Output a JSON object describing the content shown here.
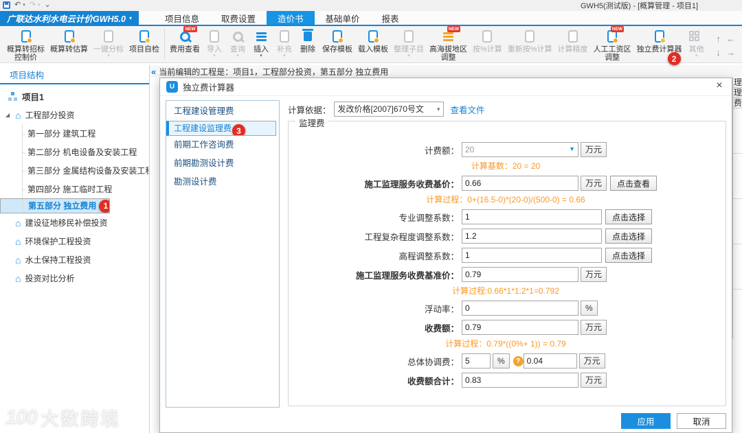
{
  "colors": {
    "accent": "#1583d3",
    "tab_active": "#1794e4",
    "orange": "#fb9827",
    "badge_red": "#e42c22",
    "selection": "#cfe9fb"
  },
  "window": {
    "title": "GWH5(测试版) - [概算管理 - 项目1]",
    "quick_access": [
      {
        "name": "save-icon",
        "glyph": "floppy"
      },
      {
        "name": "undo-icon",
        "glyph": "↶",
        "caret": true
      },
      {
        "name": "redo-icon",
        "glyph": "↷",
        "caret": true,
        "disabled": true
      },
      {
        "name": "customize-quick-access-icon",
        "glyph": "⌄"
      }
    ]
  },
  "menu": {
    "app_button": "广联达水利水电云计价GWH5.0",
    "app_caret": "▾",
    "tabs": [
      {
        "name": "tab-project-info",
        "label": "项目信息",
        "active": false
      },
      {
        "name": "tab-fee-settings",
        "label": "取费设置",
        "active": false
      },
      {
        "name": "tab-pricing-book",
        "label": "造价书",
        "active": true
      },
      {
        "name": "tab-base-unit-price",
        "label": "基础单价",
        "active": false
      },
      {
        "name": "tab-reports",
        "label": "报表",
        "active": false
      }
    ]
  },
  "ribbon": {
    "buttons": [
      {
        "name": "budget-to-bid-control-price",
        "label": "概算转招标\n控制价",
        "icon": "doc",
        "dot": "#f5a623"
      },
      {
        "name": "budget-to-estimate",
        "label": "概算转估算",
        "icon": "doc",
        "dot": "#f5a623"
      },
      {
        "name": "one-click-split",
        "label": "一键分标",
        "icon": "doc",
        "disabled": true,
        "caret": true
      },
      {
        "name": "project-self-check",
        "label": "项目自检",
        "icon": "doc",
        "dot": "#f0c22e",
        "sep_after": true
      },
      {
        "name": "fee-view",
        "label": "费用查看",
        "icon": "search",
        "color": "#1a8fe0",
        "badge": "NEW"
      },
      {
        "name": "import",
        "label": "导入",
        "icon": "doc",
        "disabled": true,
        "caret": true
      },
      {
        "name": "query",
        "label": "查询",
        "icon": "search",
        "disabled": true,
        "caret": true
      },
      {
        "name": "insert",
        "label": "插入",
        "icon": "lines",
        "color": "#1a8fe0",
        "caret": true
      },
      {
        "name": "supplement",
        "label": "补充",
        "icon": "doc",
        "disabled": true,
        "caret": true
      },
      {
        "name": "delete",
        "label": "删除",
        "icon": "trash",
        "color": "#1a8fe0"
      },
      {
        "name": "save-template",
        "label": "保存模板",
        "icon": "doc",
        "dot": "#f5a623"
      },
      {
        "name": "load-template",
        "label": "载入模板",
        "icon": "doc",
        "dot": "#f5a623"
      },
      {
        "name": "organize-subitems",
        "label": "整理子目",
        "icon": "doc",
        "disabled": true,
        "caret": true
      },
      {
        "name": "high-altitude-area-adjust",
        "label": "高海拔地区\n调整",
        "icon": "lines",
        "color": "#f5a623",
        "badge": "NEW"
      },
      {
        "name": "calc-by-percent",
        "label": "按%计算",
        "icon": "doc",
        "disabled": true
      },
      {
        "name": "recalc-by-percent",
        "label": "重新按%计算",
        "icon": "doc",
        "disabled": true
      },
      {
        "name": "calc-precision",
        "label": "计算精度",
        "icon": "doc",
        "disabled": true
      },
      {
        "name": "labor-wage-zone-adjust",
        "label": "人工工资区\n调整",
        "icon": "doc",
        "dot": "#f5a623",
        "badge": "NEW"
      },
      {
        "name": "independent-fee-calculator",
        "label": "独立费计算器",
        "icon": "doc",
        "dot": "#f0c22e",
        "annotation": "2"
      },
      {
        "name": "other",
        "label": "其他",
        "icon": "grid",
        "disabled": true,
        "caret": true
      }
    ],
    "nav_arrows": [
      "↑",
      "←",
      "↓",
      "→"
    ]
  },
  "sidebar": {
    "tab": "项目结构",
    "tree": [
      {
        "name": "tree-item-project-1",
        "label": "项目1",
        "level": 0,
        "icon": "org"
      },
      {
        "name": "tree-item-engineering-investment",
        "label": "工程部分投资",
        "level": 1,
        "icon": "house",
        "caret": "◢"
      },
      {
        "name": "tree-item-part1-construction",
        "label": "第一部分 建筑工程",
        "level": 2
      },
      {
        "name": "tree-item-part2-mechanical",
        "label": "第二部分 机电设备及安装工程",
        "level": 2
      },
      {
        "name": "tree-item-part3-metal-structure",
        "label": "第三部分 金属结构设备及安装工程",
        "level": 2
      },
      {
        "name": "tree-item-part4-temporary-works",
        "label": "第四部分 施工临时工程",
        "level": 2
      },
      {
        "name": "tree-item-part5-independent-fee",
        "label": "第五部分 独立费用",
        "level": 2,
        "selected": true,
        "badge": "1"
      },
      {
        "name": "tree-item-land-resettlement",
        "label": "建设征地移民补偿投资",
        "level": 1,
        "icon": "house"
      },
      {
        "name": "tree-item-environment-protection",
        "label": "环境保护工程投资",
        "level": 1,
        "icon": "house"
      },
      {
        "name": "tree-item-soil-water-conservation",
        "label": "水土保持工程投资",
        "level": 1,
        "icon": "house"
      },
      {
        "name": "tree-item-investment-comparison",
        "label": "投资对比分析",
        "level": 1,
        "icon": "house"
      }
    ]
  },
  "breadcrumb": {
    "collapse": "«",
    "text": "当前编辑的工程是：项目1，工程部分投资，第五部分 独立费用"
  },
  "background_table": {
    "fragments": [
      "理",
      "理",
      "费"
    ]
  },
  "dialog": {
    "title": "独立费计算器",
    "icon_glyph": "U",
    "close": "×",
    "list": [
      {
        "name": "list-item-construction-management-fee",
        "label": "工程建设管理费"
      },
      {
        "name": "list-item-construction-supervision-fee",
        "label": "工程建设监理费",
        "selected": true,
        "badge": "3"
      },
      {
        "name": "list-item-preliminary-consulting-fee",
        "label": "前期工作咨询费"
      },
      {
        "name": "list-item-preliminary-survey-design-fee",
        "label": "前期勘测设计费"
      },
      {
        "name": "list-item-survey-design-fee",
        "label": "勘测设计费"
      }
    ],
    "basis_label": "计算依据：",
    "basis_value": "发改价格[2007]670号文",
    "view_file_link": "查看文件",
    "group_title": "监理费",
    "rows": [
      {
        "type": "field",
        "name": "fee-base-amount",
        "label": "计费额：",
        "value": "20",
        "unit": "万元",
        "dropdown": true,
        "muted": true
      },
      {
        "type": "calc",
        "name": "calc-base-note",
        "text": "计算基数：20 = 20"
      },
      {
        "type": "field",
        "name": "supervision-service-base-price",
        "label": "施工监理服务收费基价：",
        "value": "0.66",
        "unit": "万元",
        "bold": true,
        "button": "点击查看"
      },
      {
        "type": "calc",
        "name": "calc-process-base-price",
        "text": "计算过程：0+(16.5-0)*(20-0)/(500-0) = 0.66"
      },
      {
        "type": "field",
        "name": "professional-adjust-factor",
        "label": "专业调整系数：",
        "value": "1",
        "button": "点击选择"
      },
      {
        "type": "field",
        "name": "complexity-adjust-factor",
        "label": "工程复杂程度调整系数：",
        "value": "1.2",
        "button": "点击选择"
      },
      {
        "type": "field",
        "name": "elevation-adjust-factor",
        "label": "高程调整系数：",
        "value": "1",
        "button": "点击选择"
      },
      {
        "type": "field",
        "name": "supervision-service-benchmark-price",
        "label": "施工监理服务收费基准价：",
        "value": "0.79",
        "unit": "万元",
        "bold": true
      },
      {
        "type": "calc",
        "name": "calc-process-benchmark",
        "text": "计算过程:0.66*1*1.2*1=0.792"
      },
      {
        "type": "field",
        "name": "float-rate",
        "label": "浮动率：",
        "value": "0",
        "unit": "%"
      },
      {
        "type": "field",
        "name": "charge-amount",
        "label": "收费额：",
        "value": "0.79",
        "unit": "万元",
        "bold": true
      },
      {
        "type": "calc",
        "name": "calc-process-charge",
        "text": "计算过程：0.79*((0%+ 1)) = 0.79"
      },
      {
        "type": "dual",
        "name": "overall-coordination-fee",
        "label": "总体协调费：",
        "value1": "5",
        "unit1": "%",
        "help": "?",
        "value2": "0.04",
        "unit2": "万元"
      },
      {
        "type": "field",
        "name": "charge-amount-total",
        "label": "收费额合计：",
        "value": "0.83",
        "unit": "万元",
        "bold": true
      }
    ],
    "footer": {
      "apply": "应用",
      "cancel": "取消"
    }
  },
  "watermark": {
    "logo": "100",
    "text": "大数跨境"
  }
}
